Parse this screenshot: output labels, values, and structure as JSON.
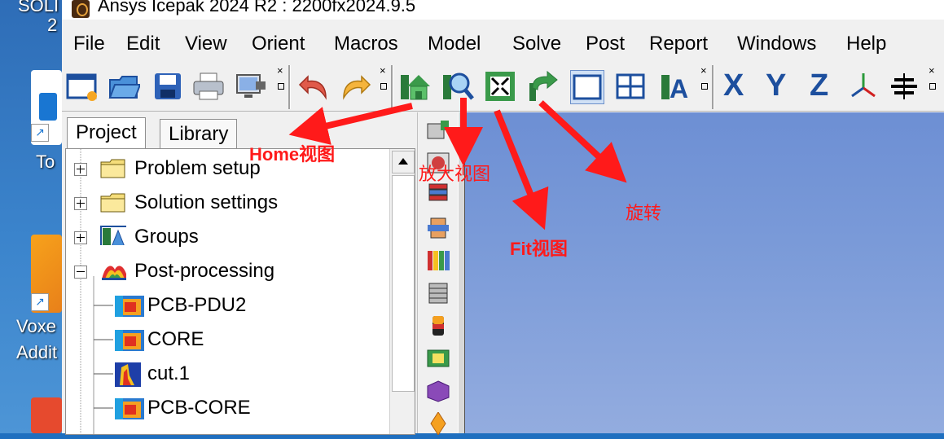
{
  "desktop": {
    "labels": [
      "SOLI",
      "2",
      "To",
      "Voxe",
      "Addit"
    ]
  },
  "window": {
    "title": "Ansys Icepak 2024 R2 : 2200fx2024.9.5"
  },
  "menu": [
    "File",
    "Edit",
    "View",
    "Orient",
    "Macros",
    "Model",
    "Solve",
    "Post",
    "Report",
    "Windows",
    "Help"
  ],
  "toolbar": {
    "axis_x": "X",
    "axis_y": "Y",
    "axis_z": "Z",
    "grip_close": "×"
  },
  "tabs": {
    "project": "Project",
    "library": "Library"
  },
  "tree": {
    "problem_setup": "Problem setup",
    "solution_settings": "Solution settings",
    "groups": "Groups",
    "post_processing": "Post-processing",
    "children": [
      "PCB-PDU2",
      "CORE",
      "cut.1",
      "PCB-CORE"
    ]
  },
  "annotations": {
    "home": "Home视图",
    "zoom": "放大视图",
    "fit": "Fit视图",
    "rotate": "旋转"
  },
  "colors": {
    "annotation": "#ff1a1a",
    "viewport_top": "#6d8fd4",
    "viewport_bottom": "#93acdf",
    "axis_letter": "#1d4f9e"
  }
}
